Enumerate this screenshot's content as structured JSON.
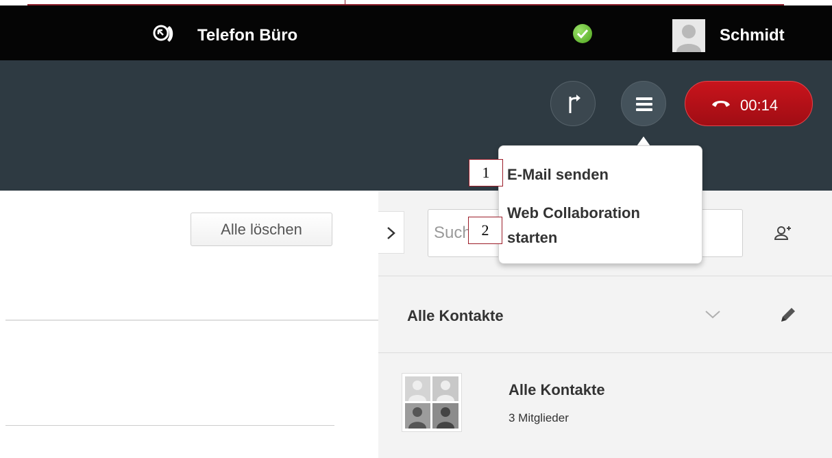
{
  "topbar": {
    "line_label": "Telefon Büro",
    "user_name": "Schmidt",
    "status_color": "#5cb82a"
  },
  "callbar": {
    "transfer_icon": "transfer-arrow-icon",
    "menu_icon": "hamburger-menu-icon",
    "timer": "00:14",
    "hangup_color": "#b51018"
  },
  "left_pane": {
    "clear_label": "Alle löschen"
  },
  "right_pane": {
    "search_placeholder": "Suchen",
    "group_header": "Alle Kontakte",
    "group_card": {
      "title": "Alle Kontakte",
      "members": "3 Mitglieder"
    }
  },
  "popover": {
    "items": [
      {
        "label": "E-Mail senden"
      },
      {
        "label": "Web Collaboration starten"
      }
    ]
  },
  "callouts": [
    "1",
    "2"
  ]
}
